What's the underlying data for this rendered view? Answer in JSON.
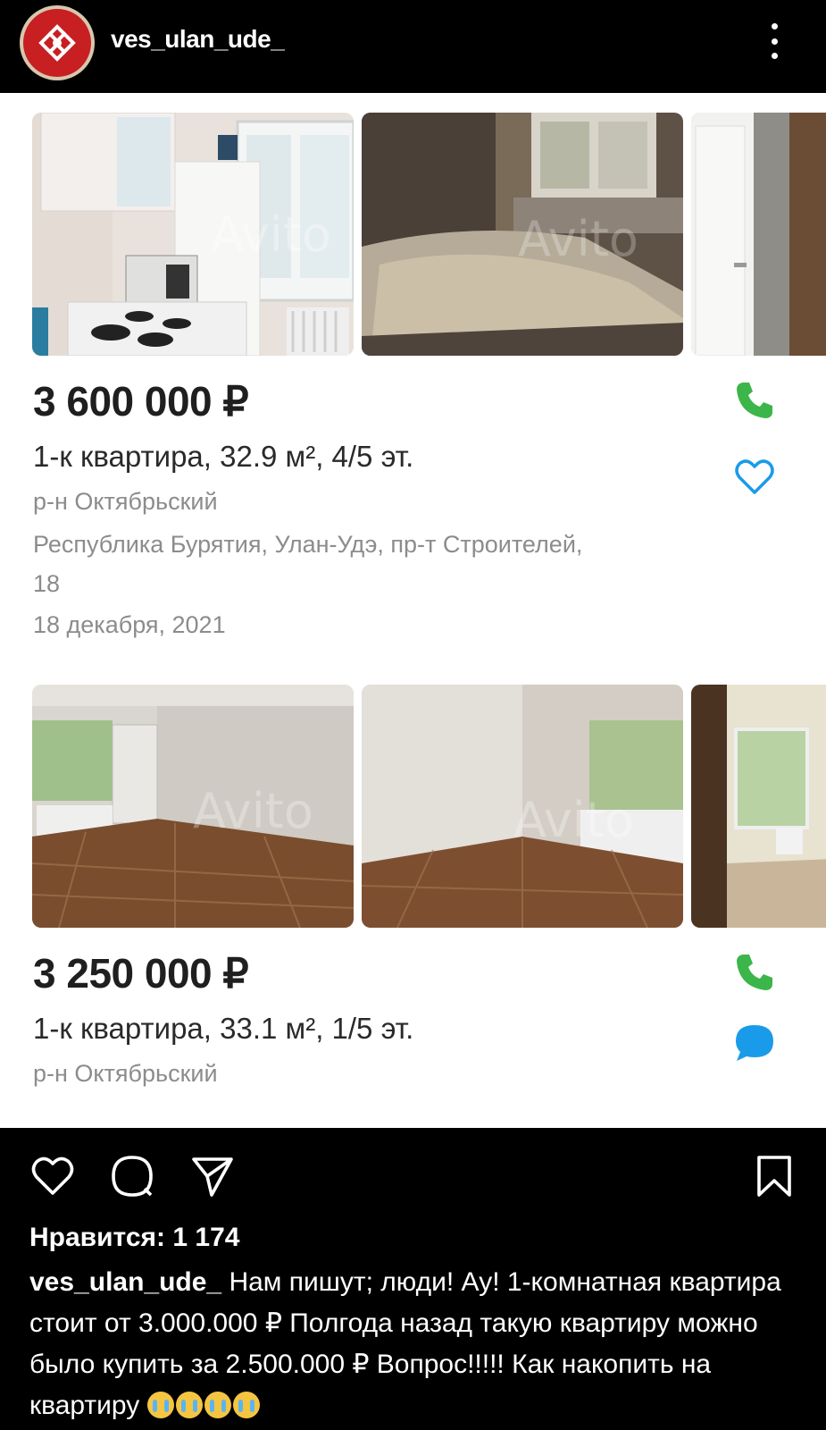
{
  "header": {
    "username": "ves_ulan_ude_",
    "avatar_icon": "knot-logo",
    "menu_icon": "kebab-menu-icon"
  },
  "listings": [
    {
      "price": "3 600 000 ₽",
      "title": "1-к квартира, 32.9 м², 4/5 эт.",
      "district": "р-н Октябрьский",
      "address_line1": "Республика Бурятия, Улан-Удэ, пр-т Строителей,",
      "address_line2": "18",
      "date": "18 декабря, 2021",
      "icons": [
        "phone-icon",
        "heart-icon"
      ],
      "watermark": "Avito"
    },
    {
      "price": "3 250 000 ₽",
      "title": "1-к квартира, 33.1 м², 1/5 эт.",
      "district": "р-н Октябрьский",
      "icons": [
        "phone-icon",
        "chat-icon"
      ],
      "watermark": "Avito"
    }
  ],
  "actions": {
    "icons": [
      "heart-icon",
      "comment-icon",
      "share-icon",
      "bookmark-icon"
    ]
  },
  "likes_label": "Нравится: 1 174",
  "caption": {
    "username": "ves_ulan_ude_",
    "text": " Нам пишут; люди! Ау! 1-комнатная квартира стоит от 3.000.000 ₽ Полгода назад такую квартиру можно было купить за 2.500.000 ₽ Вопрос!!!!! Как накопить на квартиру ",
    "emoji": [
      "crying-face",
      "crying-face",
      "crying-face",
      "crying-face"
    ]
  },
  "colors": {
    "accent_green": "#3cb54a",
    "accent_blue": "#1a9bea",
    "logo_red": "#c71f22"
  }
}
